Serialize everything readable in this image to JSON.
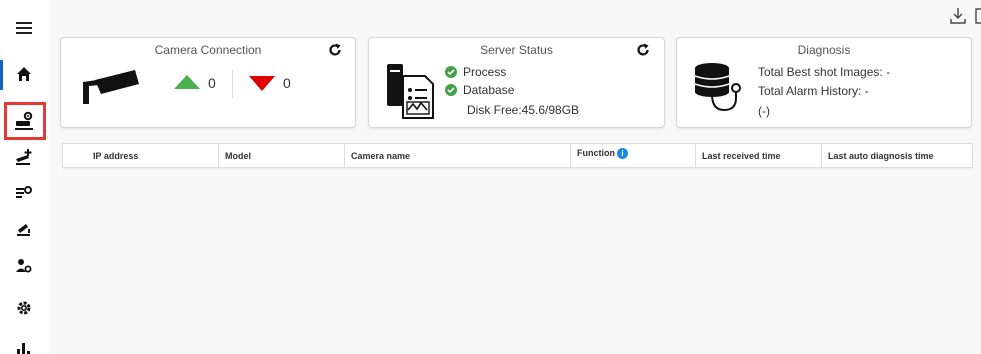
{
  "sidebar": {
    "items": [
      {
        "name": "menu-icon"
      },
      {
        "name": "home-icon"
      },
      {
        "name": "camera-settings-icon"
      },
      {
        "name": "camera-add-icon"
      },
      {
        "name": "camera-list-settings-icon"
      },
      {
        "name": "alarm-camera-icon"
      },
      {
        "name": "user-settings-icon"
      },
      {
        "name": "gear-icon"
      },
      {
        "name": "bar-chart-icon"
      }
    ],
    "active_item": "home-icon",
    "highlighted_item": "camera-settings-icon"
  },
  "toolbar": {
    "icons": [
      "download-icon",
      "window-icon"
    ]
  },
  "camera_connection": {
    "title": "Camera Connection",
    "up_count": "0",
    "down_count": "0",
    "up_color": "#4caf50",
    "down_color": "#e00000"
  },
  "server_status": {
    "title": "Server Status",
    "process_label": "Process",
    "database_label": "Database",
    "disk_free": "Disk Free:45.6/98GB",
    "ok_color": "#43a047"
  },
  "diagnosis": {
    "title": "Diagnosis",
    "best_shot": "Total Best shot Images: -",
    "alarm_history": "Total Alarm History: -",
    "extra": "(-)"
  },
  "table": {
    "columns": [
      "IP address",
      "Model",
      "Camera name",
      "Function",
      "Last received time",
      "Last auto diagnosis time"
    ],
    "function_info_icon": "info-icon",
    "info_color": "#1e88e5"
  },
  "colors": {
    "accent": "#1565c0",
    "highlight": "#e53935"
  }
}
